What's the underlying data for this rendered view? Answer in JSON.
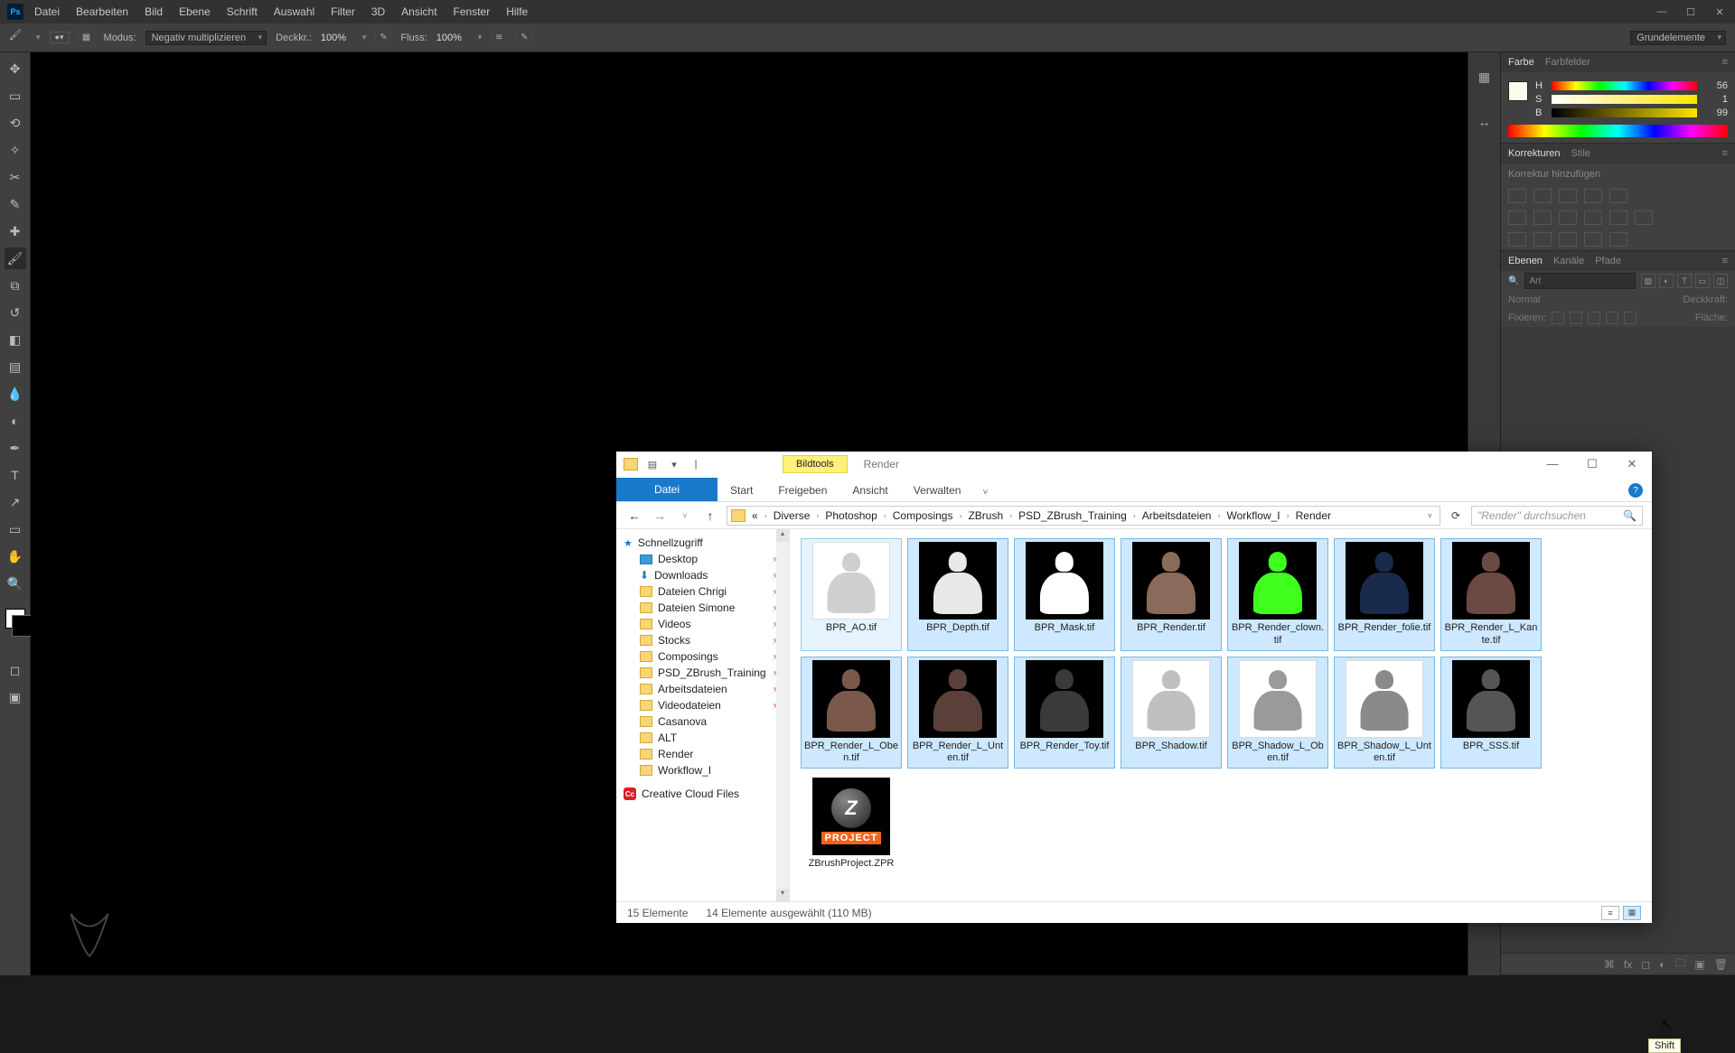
{
  "ps": {
    "menu": [
      "Datei",
      "Bearbeiten",
      "Bild",
      "Ebene",
      "Schrift",
      "Auswahl",
      "Filter",
      "3D",
      "Ansicht",
      "Fenster",
      "Hilfe"
    ],
    "logo": "Ps",
    "options": {
      "mode_label": "Modus:",
      "mode_value": "Negativ multiplizieren",
      "opacity_label": "Deckkr.:",
      "opacity_value": "100%",
      "flow_label": "Fluss:",
      "flow_value": "100%",
      "right_label": "Grundelemente"
    },
    "panels": {
      "color_tab": "Farbe",
      "swatch_tab": "Farbfelder",
      "h": "H",
      "s": "S",
      "b": "B",
      "h_val": "56",
      "s_val": "1",
      "b_val": "99",
      "adjust_tab": "Korrekturen",
      "styles_tab": "Stile",
      "adjust_hint": "Korrektur hinzufügen",
      "layers_tab": "Ebenen",
      "channels_tab": "Kanäle",
      "paths_tab": "Pfade",
      "layers_search_ph": "Art",
      "blend_mode": "Normal",
      "opacity_lbl": "Deckkraft:",
      "fixate_lbl": "Fixieren:",
      "fill_lbl": "Fläche:"
    }
  },
  "explorer": {
    "context_tab": "Bildtools",
    "window_title": "Render",
    "ribbon": {
      "file": "Datei",
      "tabs": [
        "Start",
        "Freigeben",
        "Ansicht",
        "Verwalten"
      ]
    },
    "nav": {
      "prefix": "«",
      "crumbs": [
        "Diverse",
        "Photoshop",
        "Composings",
        "ZBrush",
        "PSD_ZBrush_Training",
        "Arbeitsdateien",
        "Workflow_I",
        "Render"
      ],
      "search_ph": "\"Render\" durchsuchen"
    },
    "tree": {
      "quick": "Schnellzugriff",
      "items": [
        "Desktop",
        "Downloads",
        "Dateien Chrigi",
        "Dateien Simone",
        "Videos",
        "Stocks",
        "Composings",
        "PSD_ZBrush_Training",
        "Arbeitsdateien",
        "Videodateien",
        "Casanova",
        "ALT",
        "Render",
        "Workflow_I"
      ],
      "cc": "Creative Cloud Files"
    },
    "files": [
      {
        "name": "BPR_AO.tif",
        "bg": "light",
        "c": "#cfcfcf"
      },
      {
        "name": "BPR_Depth.tif",
        "bg": "dark",
        "c": "#e8e8e8"
      },
      {
        "name": "BPR_Mask.tif",
        "bg": "dark",
        "c": "#ffffff"
      },
      {
        "name": "BPR_Render.tif",
        "bg": "dark",
        "c": "#8a6a5a"
      },
      {
        "name": "BPR_Render_clown.tif",
        "bg": "dark",
        "c": "#3eff1e"
      },
      {
        "name": "BPR_Render_folie.tif",
        "bg": "dark",
        "c": "#1a2a4a"
      },
      {
        "name": "BPR_Render_L_Kante.tif",
        "bg": "dark",
        "c": "#6a4a42"
      },
      {
        "name": "BPR_Render_L_Oben.tif",
        "bg": "dark",
        "c": "#7a584c"
      },
      {
        "name": "BPR_Render_L_Unten.tif",
        "bg": "dark",
        "c": "#5a4038"
      },
      {
        "name": "BPR_Render_Toy.tif",
        "bg": "dark",
        "c": "#3a3a3a"
      },
      {
        "name": "BPR_Shadow.tif",
        "bg": "light",
        "c": "#bfbfbf"
      },
      {
        "name": "BPR_Shadow_L_Oben.tif",
        "bg": "light",
        "c": "#9a9a9a"
      },
      {
        "name": "BPR_Shadow_L_Unten.tif",
        "bg": "light",
        "c": "#8a8a8a"
      },
      {
        "name": "BPR_SSS.tif",
        "bg": "dark",
        "c": "#555555"
      }
    ],
    "zpr": {
      "name": "ZBrushProject.ZPR",
      "badge": "PROJECT",
      "z": "Z"
    },
    "shift": "Shift",
    "status": {
      "count": "15 Elemente",
      "sel": "14 Elemente ausgewählt (110 MB)"
    }
  }
}
